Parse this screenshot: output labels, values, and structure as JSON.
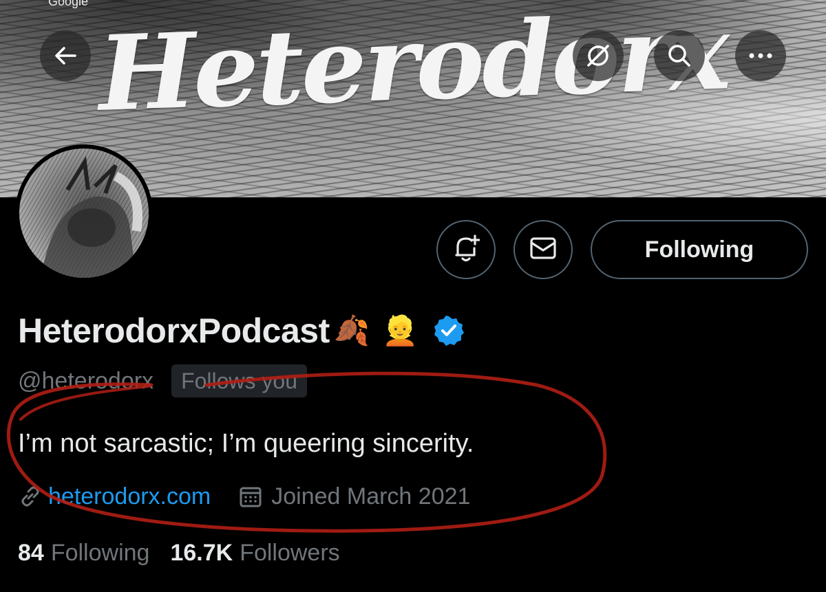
{
  "banner": {
    "top_text": "Google",
    "wordmark": "Heterodorx"
  },
  "icons": {
    "back": "arrow-left-icon",
    "grok": "grok-slash-icon",
    "search": "search-icon",
    "more": "more-horizontal-icon",
    "notify": "bell-plus-icon",
    "message": "envelope-icon",
    "link": "link-icon",
    "calendar": "calendar-icon",
    "verified": "verified-badge-icon"
  },
  "profile": {
    "display_name": "HeterodorxPodcast",
    "emoji_leaves": "🍂",
    "emoji_person": "👱",
    "handle": "@heterodorx",
    "follows_you": "Follows you",
    "bio": "I’m not sarcastic; I’m queering sincerity.",
    "website": "heterodorx.com",
    "joined": "Joined March 2021",
    "following_count": "84",
    "following_label": "Following",
    "followers_count": "16.7K",
    "followers_label": "Followers"
  },
  "actions": {
    "follow_button_label": "Following"
  },
  "colors": {
    "background": "#000000",
    "text_primary": "#e7e9ea",
    "text_secondary": "#71767b",
    "link": "#1d9bf0",
    "verified": "#1d9bf0",
    "annotation": "#b01e14"
  }
}
